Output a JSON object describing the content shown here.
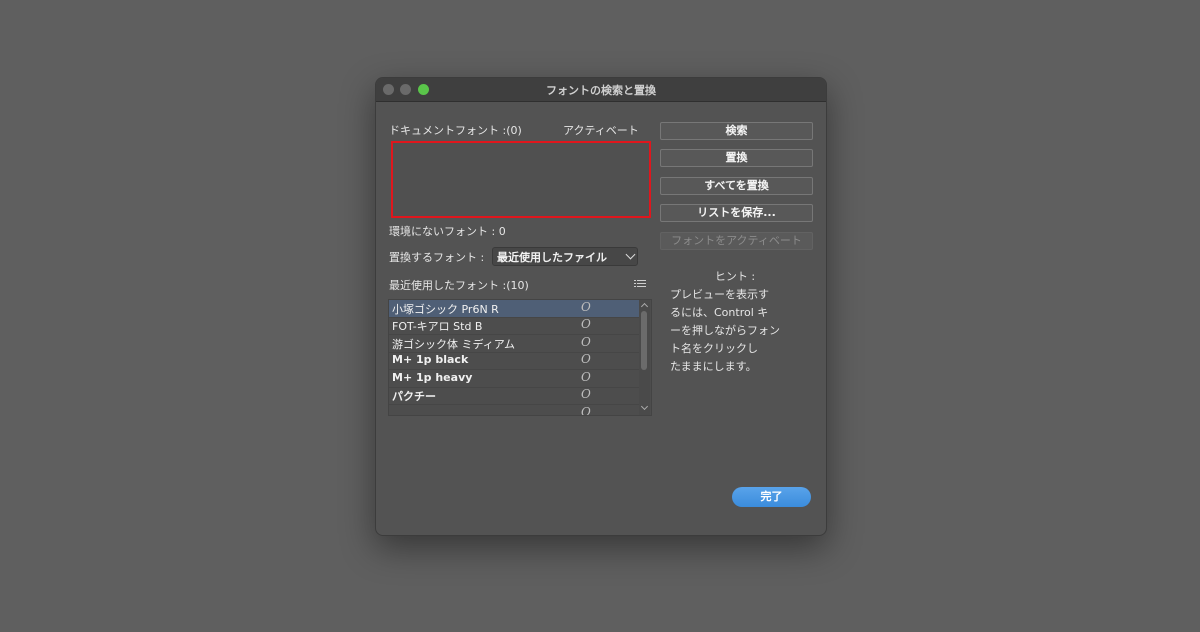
{
  "window": {
    "title": "フォントの検索と置換"
  },
  "document_fonts": {
    "label": "ドキュメントフォント :(0)",
    "activate_header": "アクティベート"
  },
  "missing_fonts": {
    "label": "環境にないフォント : 0"
  },
  "replace_with": {
    "label": "置換するフォント :",
    "selected": "最近使用したファイル"
  },
  "recent_fonts": {
    "label": "最近使用したフォント :(10)",
    "items": [
      {
        "name": "小塚ゴシック Pr6N R",
        "type": "O"
      },
      {
        "name": "FOT-キアロ Std B",
        "type": "O"
      },
      {
        "name": "游ゴシック体 ミディアム",
        "type": "O"
      },
      {
        "name": "M+ 1p black",
        "type": "O"
      },
      {
        "name": "M+ 1p heavy",
        "type": "O"
      },
      {
        "name": "パクチー",
        "type": "O"
      },
      {
        "name": "",
        "type": "O"
      }
    ]
  },
  "buttons": {
    "find": "検索",
    "replace": "置換",
    "replace_all": "すべてを置換",
    "save_list": "リストを保存...",
    "activate_font": "フォントをアクティベート",
    "done": "完了"
  },
  "hint": {
    "title": "ヒント :",
    "lines": [
      "プレビューを表示す",
      "るには、Control キ",
      "ーを押しながらフォン",
      "ト名をクリックし",
      "たままにします。"
    ]
  },
  "colors": {
    "accent": "#3b8cdc",
    "highlight_border": "#e0161d",
    "selection": "#4f5f76"
  }
}
